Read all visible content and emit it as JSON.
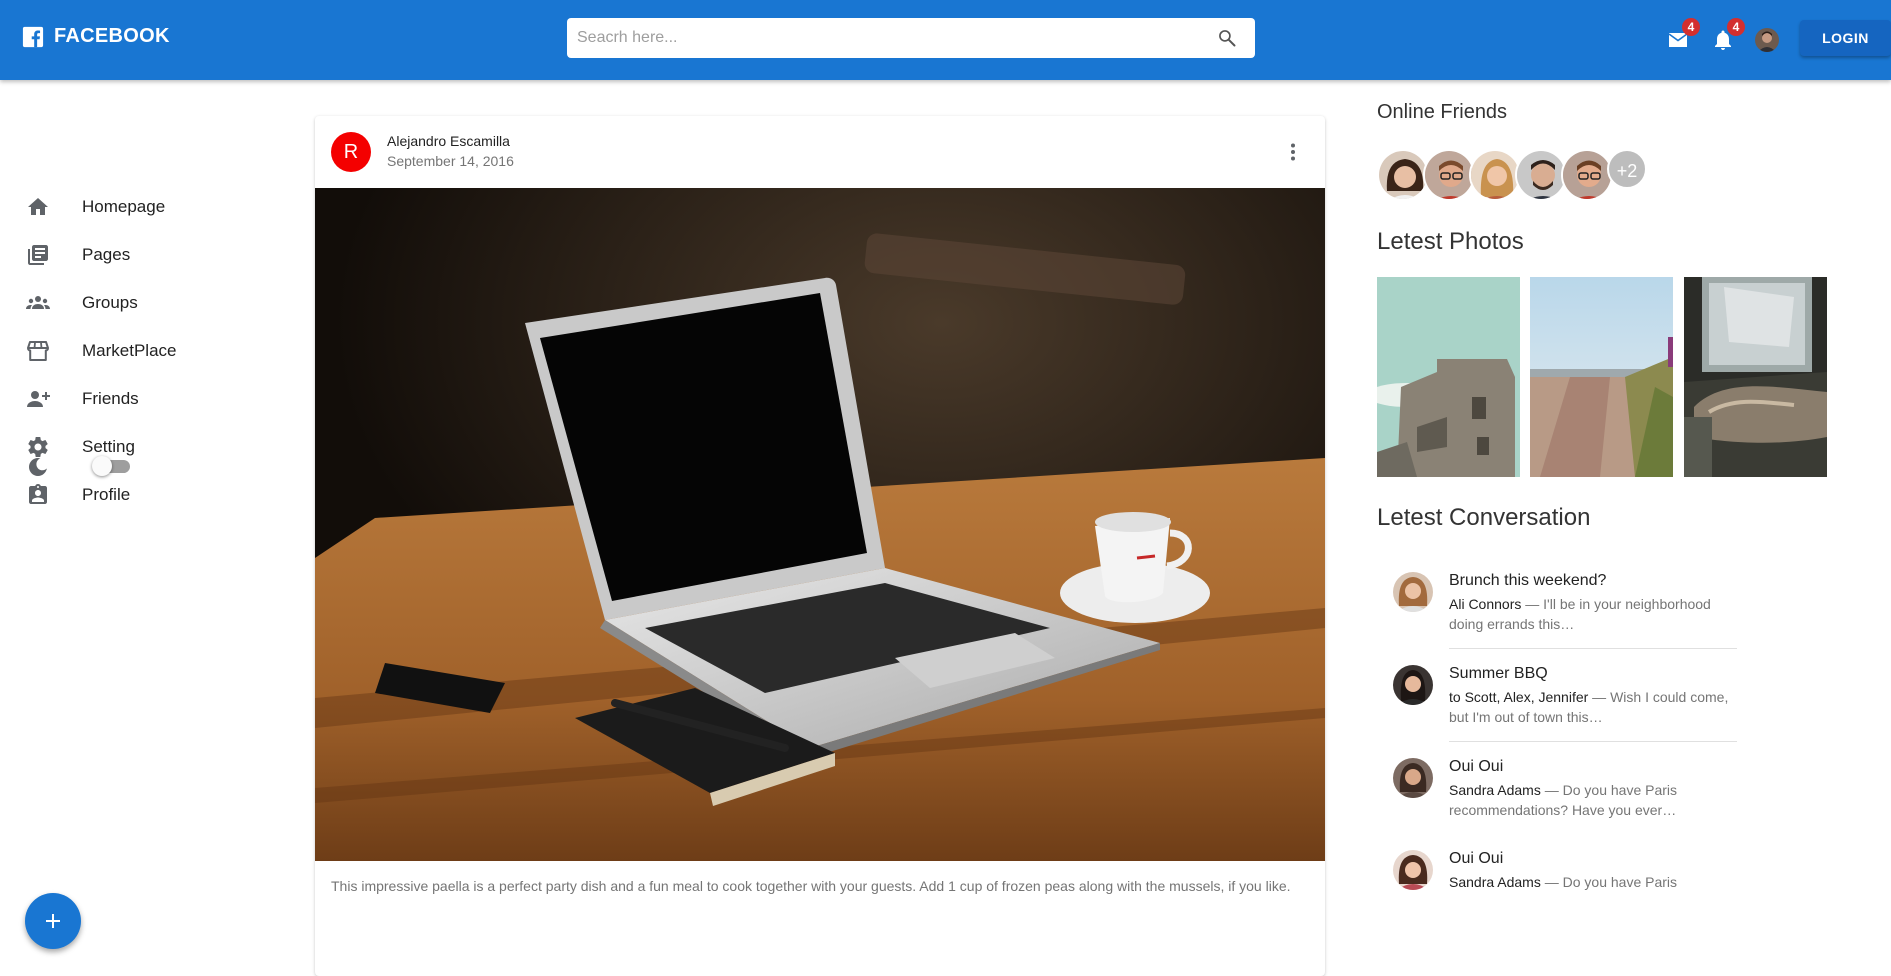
{
  "header": {
    "brand": "FACEBOOK",
    "search_placeholder": "Seacrh here...",
    "mail_badge": "4",
    "notification_badge": "4",
    "login_label": "LOGIN"
  },
  "sidebar": {
    "items": [
      {
        "label": "Homepage",
        "icon": "home-icon"
      },
      {
        "label": "Pages",
        "icon": "pages-icon"
      },
      {
        "label": "Groups",
        "icon": "groups-icon"
      },
      {
        "label": "MarketPlace",
        "icon": "storefront-icon"
      },
      {
        "label": "Friends",
        "icon": "person-add-icon"
      },
      {
        "label": "Setting",
        "icon": "gear-icon"
      },
      {
        "label": "Profile",
        "icon": "profile-badge-icon"
      }
    ],
    "dark_mode_on": false
  },
  "post": {
    "avatar_letter": "R",
    "author": "Alejandro Escamilla",
    "date": "September 14, 2016",
    "caption": "This impressive paella is a perfect party dish and a fun meal to cook together with your guests. Add 1 cup of frozen peas along with the mussels, if you like."
  },
  "right": {
    "online_friends_title": "Online Friends",
    "more_friends": "+2",
    "latest_photos_title": "Letest Photos",
    "latest_conversation_title": "Letest Conversation",
    "conversations": [
      {
        "title": "Brunch this weekend?",
        "from": "Ali Connors",
        "preview": " — I'll be in your neighborhood doing errands this…"
      },
      {
        "title": "Summer BBQ",
        "from": "to Scott, Alex, Jennifer",
        "preview": " — Wish I could come, but I'm out of town this…"
      },
      {
        "title": "Oui Oui",
        "from": "Sandra Adams",
        "preview": " — Do you have Paris recommendations? Have you ever…"
      },
      {
        "title": "Oui Oui",
        "from": "Sandra Adams",
        "preview": " — Do you have Paris"
      }
    ]
  },
  "colors": {
    "appbar": "#1976d2",
    "badge": "#d32f2f",
    "post_avatar": "#f40000"
  }
}
